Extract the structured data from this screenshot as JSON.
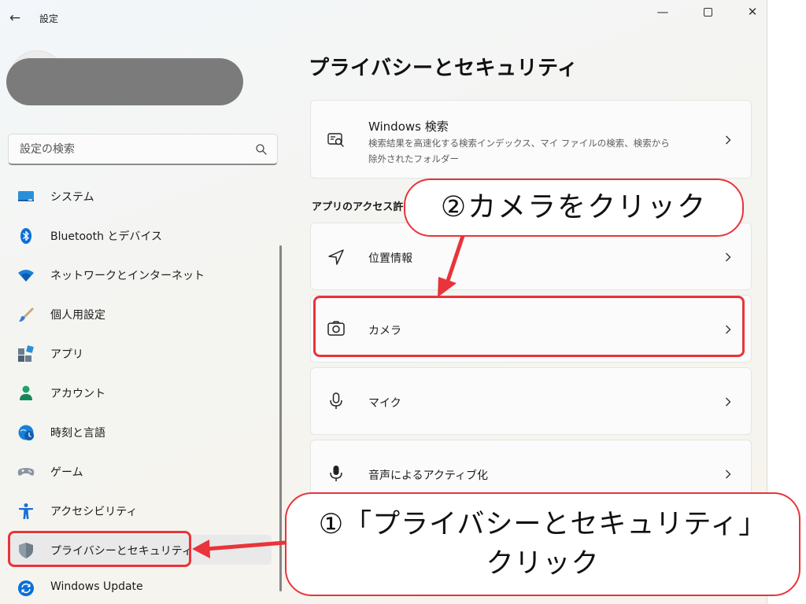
{
  "titlebar": {
    "back_glyph": "←",
    "app_title": "設定",
    "minimize_glyph": "—",
    "close_glyph": "✕"
  },
  "search": {
    "placeholder": "設定の検索"
  },
  "sidebar": {
    "items": [
      {
        "label": "システム",
        "icon": "system-display-icon"
      },
      {
        "label": "Bluetooth とデバイス",
        "icon": "bluetooth-icon"
      },
      {
        "label": "ネットワークとインターネット",
        "icon": "wifi-icon"
      },
      {
        "label": "個人用設定",
        "icon": "brush-icon"
      },
      {
        "label": "アプリ",
        "icon": "apps-icon"
      },
      {
        "label": "アカウント",
        "icon": "account-icon"
      },
      {
        "label": "時刻と言語",
        "icon": "time-language-icon"
      },
      {
        "label": "ゲーム",
        "icon": "gamepad-icon"
      },
      {
        "label": "アクセシビリティ",
        "icon": "accessibility-icon"
      },
      {
        "label": "プライバシーとセキュリティ",
        "icon": "shield-icon",
        "selected": true
      },
      {
        "label": "Windows Update",
        "icon": "windows-update-icon"
      }
    ]
  },
  "main": {
    "page_title": "プライバシーとセキュリティ",
    "windows_search": {
      "label": "Windows 検索",
      "description_line1": "検索結果を高速化する検索インデックス、マイ ファイルの検索、検索から",
      "description_line2": "除外されたフォルダー"
    },
    "section_heading": "アプリのアクセス許",
    "permissions": [
      {
        "label": "位置情報",
        "icon": "location-icon"
      },
      {
        "label": "カメラ",
        "icon": "camera-icon"
      },
      {
        "label": "マイク",
        "icon": "microphone-outline-icon"
      },
      {
        "label": "音声によるアクティブ化",
        "icon": "microphone-filled-icon"
      }
    ]
  },
  "annotations": {
    "callout_camera": "②カメラをクリック",
    "callout_privacy_line1": "①「プライバシーとセキュリティ」",
    "callout_privacy_line2": "クリック",
    "highlight_color": "#e8343a"
  },
  "colors": {
    "accent_blue": "#0067c0",
    "selected_bg": "#e9e9ea"
  }
}
